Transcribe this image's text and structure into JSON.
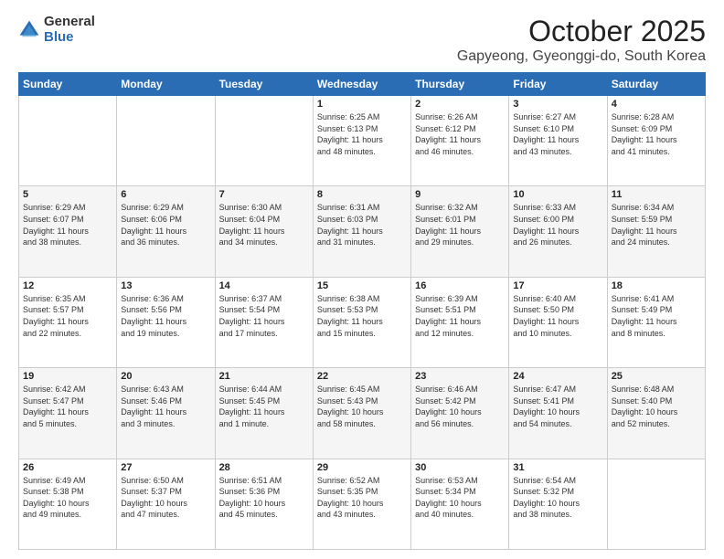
{
  "logo": {
    "general": "General",
    "blue": "Blue"
  },
  "header": {
    "month": "October 2025",
    "location": "Gapyeong, Gyeonggi-do, South Korea"
  },
  "weekdays": [
    "Sunday",
    "Monday",
    "Tuesday",
    "Wednesday",
    "Thursday",
    "Friday",
    "Saturday"
  ],
  "weeks": [
    [
      {
        "day": "",
        "info": ""
      },
      {
        "day": "",
        "info": ""
      },
      {
        "day": "",
        "info": ""
      },
      {
        "day": "1",
        "info": "Sunrise: 6:25 AM\nSunset: 6:13 PM\nDaylight: 11 hours\nand 48 minutes."
      },
      {
        "day": "2",
        "info": "Sunrise: 6:26 AM\nSunset: 6:12 PM\nDaylight: 11 hours\nand 46 minutes."
      },
      {
        "day": "3",
        "info": "Sunrise: 6:27 AM\nSunset: 6:10 PM\nDaylight: 11 hours\nand 43 minutes."
      },
      {
        "day": "4",
        "info": "Sunrise: 6:28 AM\nSunset: 6:09 PM\nDaylight: 11 hours\nand 41 minutes."
      }
    ],
    [
      {
        "day": "5",
        "info": "Sunrise: 6:29 AM\nSunset: 6:07 PM\nDaylight: 11 hours\nand 38 minutes."
      },
      {
        "day": "6",
        "info": "Sunrise: 6:29 AM\nSunset: 6:06 PM\nDaylight: 11 hours\nand 36 minutes."
      },
      {
        "day": "7",
        "info": "Sunrise: 6:30 AM\nSunset: 6:04 PM\nDaylight: 11 hours\nand 34 minutes."
      },
      {
        "day": "8",
        "info": "Sunrise: 6:31 AM\nSunset: 6:03 PM\nDaylight: 11 hours\nand 31 minutes."
      },
      {
        "day": "9",
        "info": "Sunrise: 6:32 AM\nSunset: 6:01 PM\nDaylight: 11 hours\nand 29 minutes."
      },
      {
        "day": "10",
        "info": "Sunrise: 6:33 AM\nSunset: 6:00 PM\nDaylight: 11 hours\nand 26 minutes."
      },
      {
        "day": "11",
        "info": "Sunrise: 6:34 AM\nSunset: 5:59 PM\nDaylight: 11 hours\nand 24 minutes."
      }
    ],
    [
      {
        "day": "12",
        "info": "Sunrise: 6:35 AM\nSunset: 5:57 PM\nDaylight: 11 hours\nand 22 minutes."
      },
      {
        "day": "13",
        "info": "Sunrise: 6:36 AM\nSunset: 5:56 PM\nDaylight: 11 hours\nand 19 minutes."
      },
      {
        "day": "14",
        "info": "Sunrise: 6:37 AM\nSunset: 5:54 PM\nDaylight: 11 hours\nand 17 minutes."
      },
      {
        "day": "15",
        "info": "Sunrise: 6:38 AM\nSunset: 5:53 PM\nDaylight: 11 hours\nand 15 minutes."
      },
      {
        "day": "16",
        "info": "Sunrise: 6:39 AM\nSunset: 5:51 PM\nDaylight: 11 hours\nand 12 minutes."
      },
      {
        "day": "17",
        "info": "Sunrise: 6:40 AM\nSunset: 5:50 PM\nDaylight: 11 hours\nand 10 minutes."
      },
      {
        "day": "18",
        "info": "Sunrise: 6:41 AM\nSunset: 5:49 PM\nDaylight: 11 hours\nand 8 minutes."
      }
    ],
    [
      {
        "day": "19",
        "info": "Sunrise: 6:42 AM\nSunset: 5:47 PM\nDaylight: 11 hours\nand 5 minutes."
      },
      {
        "day": "20",
        "info": "Sunrise: 6:43 AM\nSunset: 5:46 PM\nDaylight: 11 hours\nand 3 minutes."
      },
      {
        "day": "21",
        "info": "Sunrise: 6:44 AM\nSunset: 5:45 PM\nDaylight: 11 hours\nand 1 minute."
      },
      {
        "day": "22",
        "info": "Sunrise: 6:45 AM\nSunset: 5:43 PM\nDaylight: 10 hours\nand 58 minutes."
      },
      {
        "day": "23",
        "info": "Sunrise: 6:46 AM\nSunset: 5:42 PM\nDaylight: 10 hours\nand 56 minutes."
      },
      {
        "day": "24",
        "info": "Sunrise: 6:47 AM\nSunset: 5:41 PM\nDaylight: 10 hours\nand 54 minutes."
      },
      {
        "day": "25",
        "info": "Sunrise: 6:48 AM\nSunset: 5:40 PM\nDaylight: 10 hours\nand 52 minutes."
      }
    ],
    [
      {
        "day": "26",
        "info": "Sunrise: 6:49 AM\nSunset: 5:38 PM\nDaylight: 10 hours\nand 49 minutes."
      },
      {
        "day": "27",
        "info": "Sunrise: 6:50 AM\nSunset: 5:37 PM\nDaylight: 10 hours\nand 47 minutes."
      },
      {
        "day": "28",
        "info": "Sunrise: 6:51 AM\nSunset: 5:36 PM\nDaylight: 10 hours\nand 45 minutes."
      },
      {
        "day": "29",
        "info": "Sunrise: 6:52 AM\nSunset: 5:35 PM\nDaylight: 10 hours\nand 43 minutes."
      },
      {
        "day": "30",
        "info": "Sunrise: 6:53 AM\nSunset: 5:34 PM\nDaylight: 10 hours\nand 40 minutes."
      },
      {
        "day": "31",
        "info": "Sunrise: 6:54 AM\nSunset: 5:32 PM\nDaylight: 10 hours\nand 38 minutes."
      },
      {
        "day": "",
        "info": ""
      }
    ]
  ]
}
